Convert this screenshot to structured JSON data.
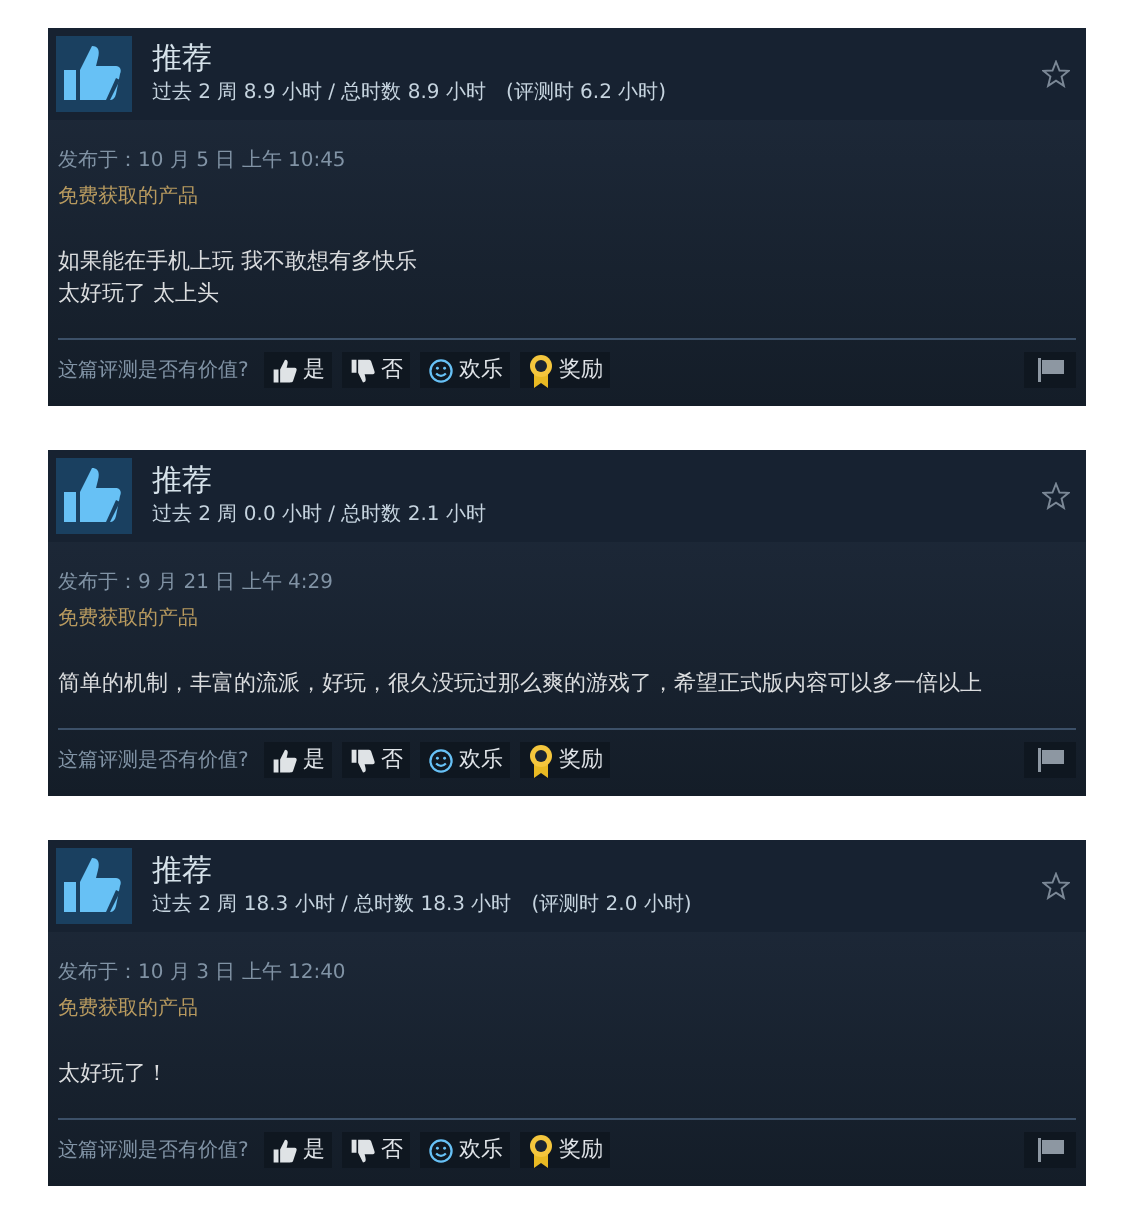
{
  "reviews": [
    {
      "title": "推荐",
      "hours": "过去 2 周 8.9 小时 / 总时数 8.9 小时",
      "review_hours": "(评测时 6.2 小时)",
      "posted": "发布于：10 月 5 日 上午 10:45",
      "product_note": "免费获取的产品",
      "text": [
        "如果能在手机上玩 我不敢想有多快乐",
        "太好玩了 太上头"
      ],
      "question": "这篇评测是否有价值?",
      "buttons": [
        {
          "kind": "yes",
          "label": "是"
        },
        {
          "kind": "no",
          "label": "否"
        },
        {
          "kind": "funny",
          "label": "欢乐"
        },
        {
          "kind": "award",
          "label": "奖励"
        }
      ]
    },
    {
      "title": "推荐",
      "hours": "过去 2 周 0.0 小时 / 总时数 2.1 小时",
      "posted": "发布于：9 月 21 日 上午 4:29",
      "product_note": "免费获取的产品",
      "text": [
        "简单的机制，丰富的流派，好玩，很久没玩过那么爽的游戏了，希望正式版内容可以多一倍以上"
      ],
      "question": "这篇评测是否有价值?",
      "buttons": [
        {
          "kind": "yes",
          "label": "是"
        },
        {
          "kind": "no",
          "label": "否"
        },
        {
          "kind": "funny",
          "label": "欢乐"
        },
        {
          "kind": "award",
          "label": "奖励"
        }
      ]
    },
    {
      "title": "推荐",
      "hours": "过去 2 周 18.3 小时 / 总时数 18.3 小时",
      "review_hours": "(评测时 2.0 小时)",
      "posted": "发布于：10 月 3 日 上午 12:40",
      "product_note": "免费获取的产品",
      "text": [
        "太好玩了！"
      ],
      "question": "这篇评测是否有价值?",
      "buttons": [
        {
          "kind": "yes",
          "label": "是"
        },
        {
          "kind": "no",
          "label": "否"
        },
        {
          "kind": "funny",
          "label": "欢乐"
        },
        {
          "kind": "award",
          "label": "奖励"
        }
      ]
    }
  ]
}
